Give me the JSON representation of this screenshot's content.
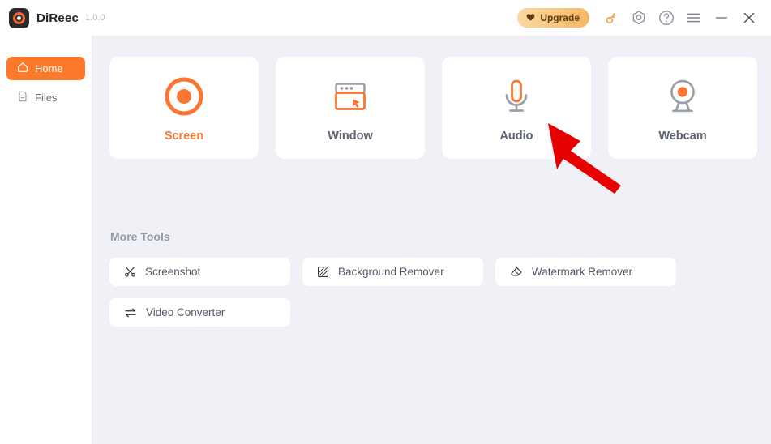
{
  "titlebar": {
    "app_name": "DiReec",
    "version": "1.0.0",
    "logo_icon": "record-ring-logo-icon",
    "upgrade_label": "Upgrade",
    "upgrade_icon": "heart-icon",
    "key_icon": "key-icon",
    "settings_icon": "hexagon-settings-icon",
    "help_icon": "question-circle-icon",
    "menu_icon": "hamburger-menu-icon",
    "minimize_icon": "minimize-icon",
    "close_icon": "close-icon",
    "accent_color": "#fb7a2b"
  },
  "sidebar": {
    "items": [
      {
        "label": "Home",
        "icon": "home-icon",
        "active": true
      },
      {
        "label": "Files",
        "icon": "file-document-icon",
        "active": false
      }
    ]
  },
  "main": {
    "cards": [
      {
        "label": "Screen",
        "icon": "record-circle-icon",
        "active": true
      },
      {
        "label": "Window",
        "icon": "browser-window-cursor-icon",
        "active": false
      },
      {
        "label": "Audio",
        "icon": "microphone-icon",
        "active": false
      },
      {
        "label": "Webcam",
        "icon": "webcam-icon",
        "active": false
      }
    ],
    "more_tools": {
      "title": "More Tools",
      "items": [
        {
          "label": "Screenshot",
          "icon": "scissors-icon"
        },
        {
          "label": "Background Remover",
          "icon": "hatched-square-icon"
        },
        {
          "label": "Watermark Remover",
          "icon": "eraser-icon"
        },
        {
          "label": "Video Converter",
          "icon": "exchange-arrows-icon"
        }
      ]
    }
  },
  "annotation": {
    "arrow_color": "#e60000",
    "points_at": "Audio"
  }
}
